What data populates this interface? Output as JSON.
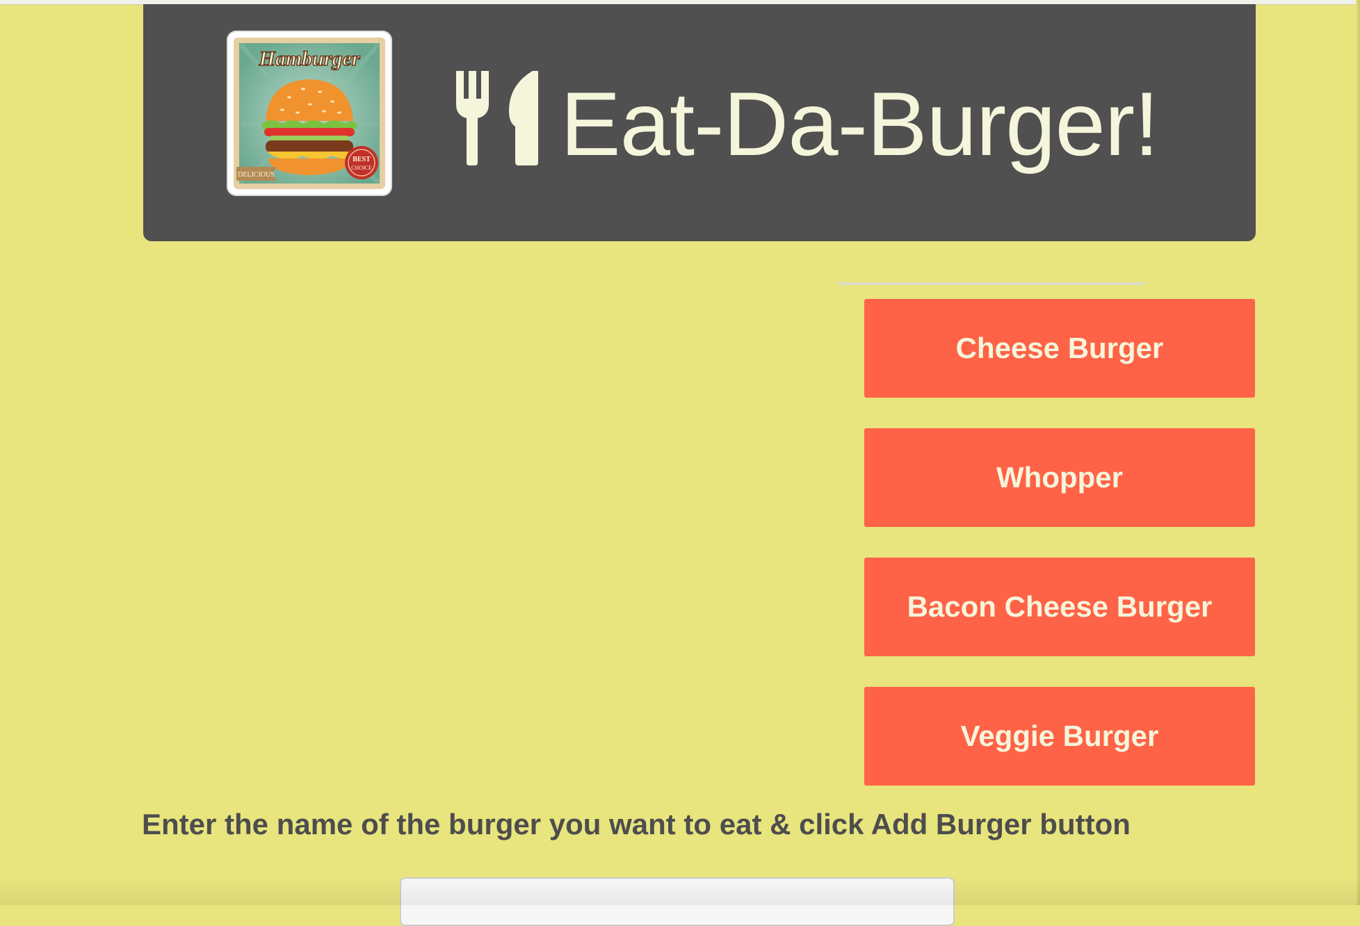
{
  "header": {
    "title": "Eat-Da-Burger!",
    "logo": {
      "title_text": "Hamburger",
      "ribbon_text": "DELICIOUS",
      "seal_line1": "BEST",
      "seal_line2": "CHOICE"
    },
    "icon": "fork-and-knife-icon"
  },
  "burgers": [
    {
      "label": "Cheese Burger"
    },
    {
      "label": "Whopper"
    },
    {
      "label": "Bacon Cheese Burger"
    },
    {
      "label": "Veggie Burger"
    }
  ],
  "form": {
    "instructions": "Enter the name of the burger you want to eat & click Add Burger button",
    "input_value": "",
    "input_placeholder": ""
  },
  "colors": {
    "page_background": "#e8e47e",
    "header_background": "#505050",
    "header_text": "#f5f5dc",
    "button_background": "#ff6347",
    "button_text": "#f5f5dc",
    "instruction_text": "#4d4d4d"
  }
}
